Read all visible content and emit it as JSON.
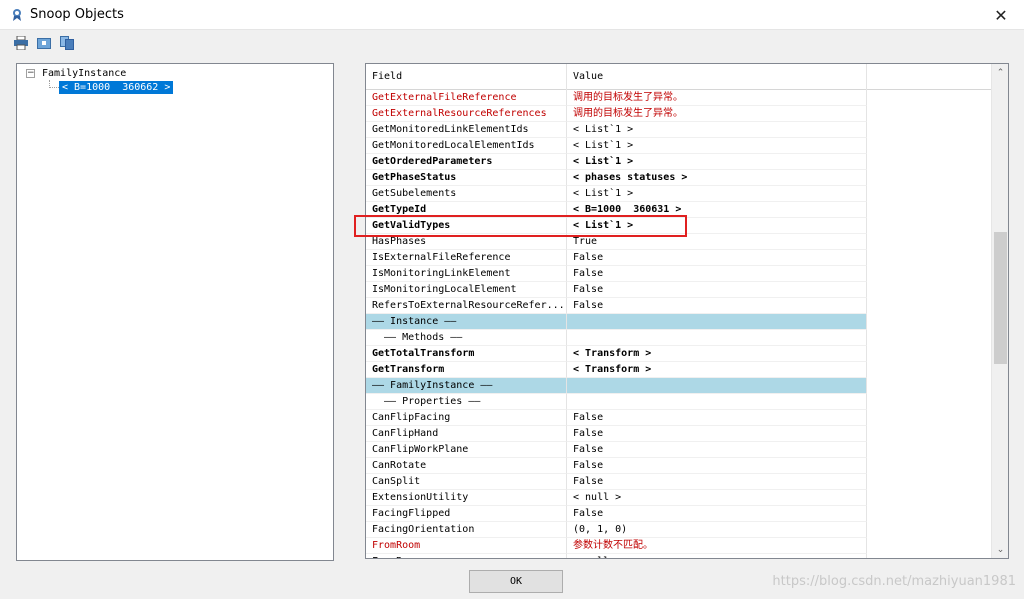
{
  "window": {
    "title": "Snoop Objects",
    "icon": "snoop-app-icon",
    "close_label": "✕"
  },
  "toolbar": {
    "buttons": [
      {
        "icon": "print-icon"
      },
      {
        "icon": "snapshot-icon"
      },
      {
        "icon": "copy-icon"
      }
    ]
  },
  "tree": {
    "toggle": "−",
    "root": "FamilyInstance",
    "child": "< B=1000  360662 >"
  },
  "grid": {
    "headers": {
      "field": "Field",
      "value": "Value"
    },
    "rows": [
      {
        "field": "GetExternalFileReference",
        "value": "调用的目标发生了异常。",
        "style": "error"
      },
      {
        "field": "GetExternalResourceReferences",
        "value": "调用的目标发生了异常。",
        "style": "error"
      },
      {
        "field": "GetMonitoredLinkElementIds",
        "value": "< List`1 >",
        "style": "normal"
      },
      {
        "field": "GetMonitoredLocalElementIds",
        "value": "< List`1 >",
        "style": "normal"
      },
      {
        "field": "GetOrderedParameters",
        "value": "< List`1 >",
        "style": "bold"
      },
      {
        "field": "GetPhaseStatus",
        "value": "< phases statuses >",
        "style": "bold"
      },
      {
        "field": "GetSubelements",
        "value": "< List`1 >",
        "style": "normal"
      },
      {
        "field": "GetTypeId",
        "value": "< B=1000  360631 >",
        "style": "bold"
      },
      {
        "field": "GetValidTypes",
        "value": "< List`1 >",
        "style": "bold"
      },
      {
        "field": "HasPhases",
        "value": "True",
        "style": "normal"
      },
      {
        "field": "IsExternalFileReference",
        "value": "False",
        "style": "normal"
      },
      {
        "field": "IsMonitoringLinkElement",
        "value": "False",
        "style": "normal"
      },
      {
        "field": "IsMonitoringLocalElement",
        "value": "False",
        "style": "normal"
      },
      {
        "field": "RefersToExternalResourceRefer...",
        "value": "False",
        "style": "normal"
      },
      {
        "field": "—— Instance ——",
        "value": "",
        "style": "section"
      },
      {
        "field": "  —— Methods ——",
        "value": "",
        "style": "subsection"
      },
      {
        "field": "GetTotalTransform",
        "value": "< Transform >",
        "style": "bold"
      },
      {
        "field": "GetTransform",
        "value": "< Transform >",
        "style": "bold"
      },
      {
        "field": "—— FamilyInstance ——",
        "value": "",
        "style": "section"
      },
      {
        "field": "  —— Properties ——",
        "value": "",
        "style": "subsection"
      },
      {
        "field": "CanFlipFacing",
        "value": "False",
        "style": "normal"
      },
      {
        "field": "CanFlipHand",
        "value": "False",
        "style": "normal"
      },
      {
        "field": "CanFlipWorkPlane",
        "value": "False",
        "style": "normal"
      },
      {
        "field": "CanRotate",
        "value": "False",
        "style": "normal"
      },
      {
        "field": "CanSplit",
        "value": "False",
        "style": "normal"
      },
      {
        "field": "ExtensionUtility",
        "value": "< null >",
        "style": "normal"
      },
      {
        "field": "FacingFlipped",
        "value": "False",
        "style": "normal"
      },
      {
        "field": "FacingOrientation",
        "value": "(0, 1, 0)",
        "style": "normal"
      },
      {
        "field": "FromRoom",
        "value": "参数计数不匹配。",
        "style": "error"
      },
      {
        "field": "FromRoom",
        "value": "< null >",
        "style": "normal"
      }
    ]
  },
  "scrollbar": {
    "up": "⌃",
    "down": "⌄"
  },
  "buttons": {
    "ok": "OK"
  },
  "watermark": "https://blog.csdn.net/mazhiyuan1981",
  "colors": {
    "section_bg": "#add8e6",
    "error_text": "#c00000",
    "highlight": "#e02020",
    "selection": "#0078d7"
  }
}
